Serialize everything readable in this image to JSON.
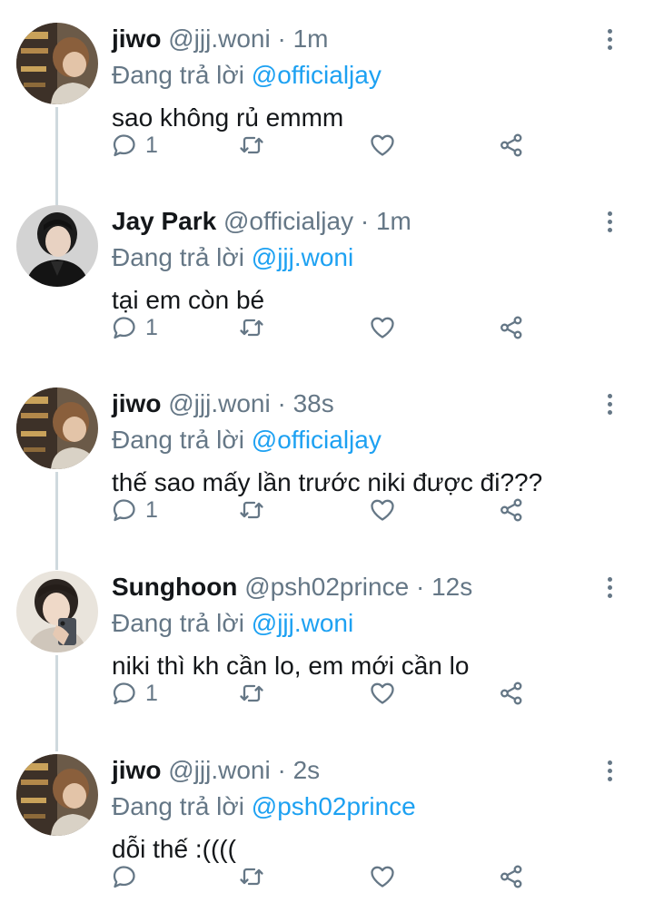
{
  "labels": {
    "replying_to": "Đang trả lời",
    "separator": "·"
  },
  "colors": {
    "mention": "#1da1f2",
    "secondary_text": "#657786",
    "primary_text": "#14171a"
  },
  "tweets": [
    {
      "name": "jiwo",
      "handle": "@jjj.woni",
      "time": "1m",
      "reply_to": "@officialjay",
      "text": "sao không rủ emmm",
      "reply_count": "1",
      "avatar": "jiwo-avatar"
    },
    {
      "name": "Jay Park",
      "handle": "@officialjay",
      "time": "1m",
      "reply_to": "@jjj.woni",
      "text": "tại em còn bé",
      "reply_count": "1",
      "avatar": "jay-avatar"
    },
    {
      "name": "jiwo",
      "handle": "@jjj.woni",
      "time": "38s",
      "reply_to": "@officialjay",
      "text": "thế sao mấy lần trước niki được đi???",
      "reply_count": "1",
      "avatar": "jiwo-avatar"
    },
    {
      "name": "Sunghoon",
      "handle": "@psh02prince",
      "time": "12s",
      "reply_to": "@jjj.woni",
      "text": "niki thì kh cần lo, em mới cần lo",
      "reply_count": "1",
      "avatar": "sunghoon-avatar"
    },
    {
      "name": "jiwo",
      "handle": "@jjj.woni",
      "time": "2s",
      "reply_to": "@psh02prince",
      "text": "dỗi thế :((((",
      "reply_count": "",
      "avatar": "jiwo-avatar"
    }
  ]
}
